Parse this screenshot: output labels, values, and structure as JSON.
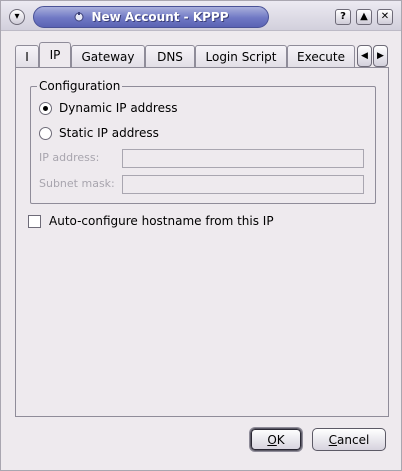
{
  "window": {
    "title": "New Account - KPPP"
  },
  "tabs": [
    {
      "label": "I",
      "active": false
    },
    {
      "label": "IP",
      "active": true
    },
    {
      "label": "Gateway",
      "active": false
    },
    {
      "label": "DNS",
      "active": false
    },
    {
      "label": "Login Script",
      "active": false
    },
    {
      "label": "Execute",
      "active": false
    }
  ],
  "configuration": {
    "title": "Configuration",
    "dynamic_label": "Dynamic IP address",
    "static_label": "Static IP address",
    "selected": "dynamic",
    "ip_label": "IP address:",
    "ip_value": "",
    "subnet_label": "Subnet mask:",
    "subnet_value": ""
  },
  "autoconfig": {
    "label": "Auto-configure hostname from this IP",
    "checked": false
  },
  "buttons": {
    "ok_underlined": "O",
    "ok_rest": "K",
    "cancel_underlined": "C",
    "cancel_rest": "ancel"
  },
  "icons": {
    "menu": "chevron-down-icon",
    "app": "kppp-icon",
    "help": "question-icon",
    "maximize": "triangle-up-icon",
    "close": "close-icon",
    "scroll_left": "triangle-left-icon",
    "scroll_right": "triangle-right-icon"
  }
}
